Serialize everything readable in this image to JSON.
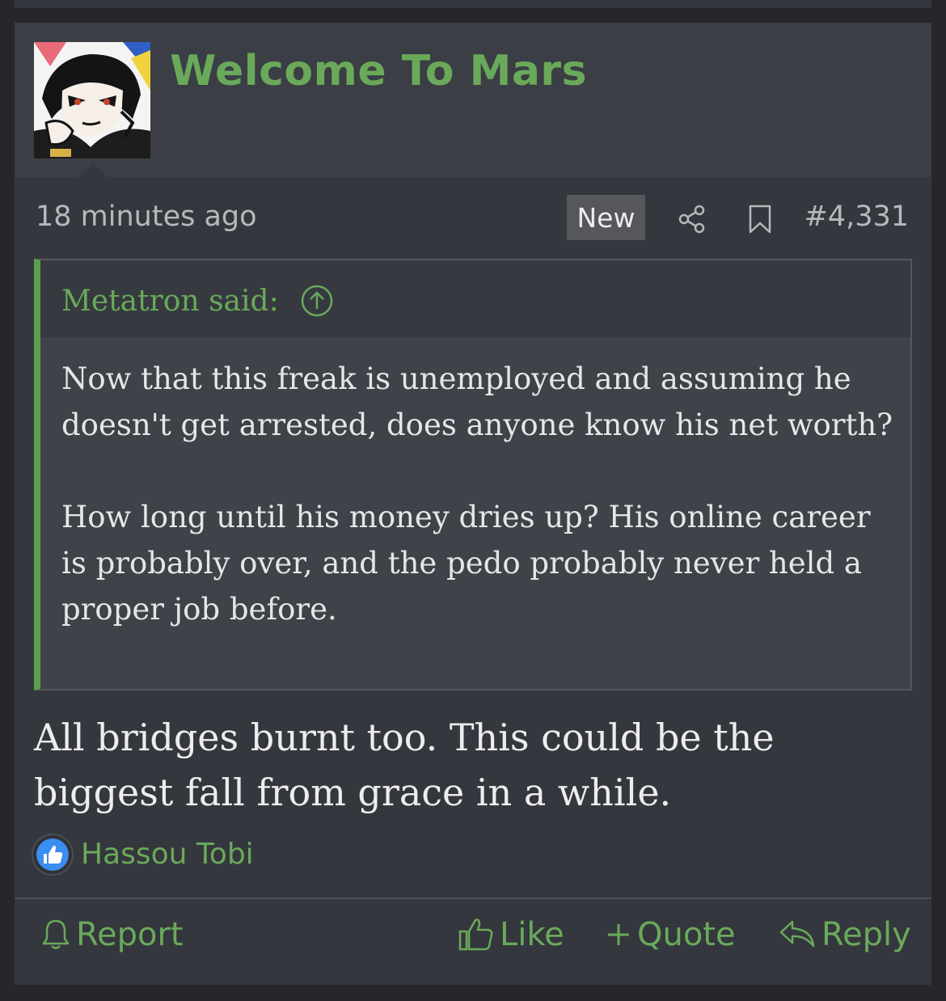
{
  "post": {
    "username": "Welcome To Mars",
    "time": "18 minutes ago",
    "new_badge": "New",
    "post_number": "#4,331",
    "quote": {
      "author_line": "Metatron said:",
      "paragraph_1": "Now that this freak is unemployed and assuming he doesn't get arrested, does anyone know his net worth?",
      "paragraph_2": "How long until his money dries up? His online career is probably over, and the pedo probably never held a proper job before."
    },
    "message": "All bridges burnt too. This could be the biggest fall from grace in a while.",
    "reactions": {
      "icon": "thumbs-up-icon",
      "user": "Hassou Tobi"
    },
    "actions": {
      "report": "Report",
      "like": "Like",
      "quote": "Quote",
      "reply": "Reply"
    }
  },
  "colors": {
    "accent": "#6aa95a",
    "background": "#34373d",
    "header": "#3b3e44",
    "quote_background": "#3e4249",
    "reaction_blue": "#3b8df0"
  }
}
